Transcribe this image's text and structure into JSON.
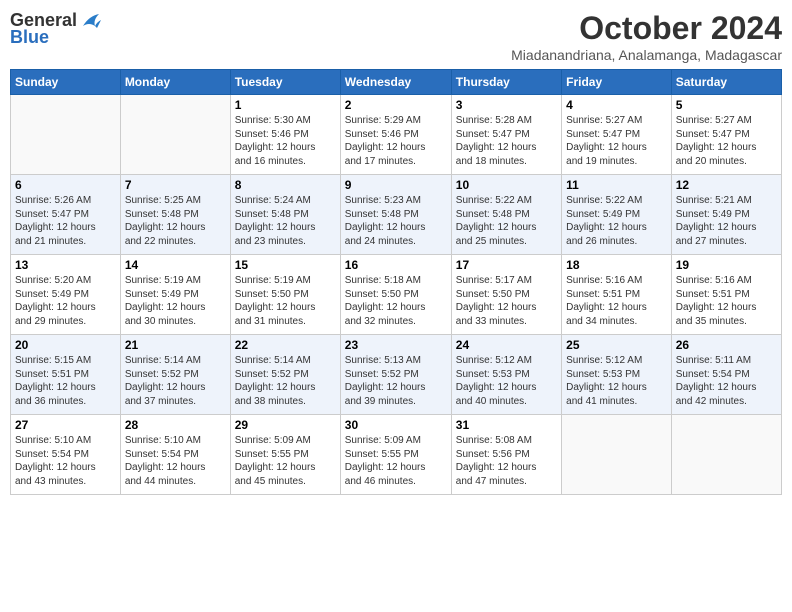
{
  "header": {
    "logo_line1": "General",
    "logo_line2": "Blue",
    "title": "October 2024",
    "location": "Miadanandriana, Analamanga, Madagascar"
  },
  "days_of_week": [
    "Sunday",
    "Monday",
    "Tuesday",
    "Wednesday",
    "Thursday",
    "Friday",
    "Saturday"
  ],
  "weeks": [
    [
      {
        "day": "",
        "info": ""
      },
      {
        "day": "",
        "info": ""
      },
      {
        "day": "1",
        "info": "Sunrise: 5:30 AM\nSunset: 5:46 PM\nDaylight: 12 hours\nand 16 minutes."
      },
      {
        "day": "2",
        "info": "Sunrise: 5:29 AM\nSunset: 5:46 PM\nDaylight: 12 hours\nand 17 minutes."
      },
      {
        "day": "3",
        "info": "Sunrise: 5:28 AM\nSunset: 5:47 PM\nDaylight: 12 hours\nand 18 minutes."
      },
      {
        "day": "4",
        "info": "Sunrise: 5:27 AM\nSunset: 5:47 PM\nDaylight: 12 hours\nand 19 minutes."
      },
      {
        "day": "5",
        "info": "Sunrise: 5:27 AM\nSunset: 5:47 PM\nDaylight: 12 hours\nand 20 minutes."
      }
    ],
    [
      {
        "day": "6",
        "info": "Sunrise: 5:26 AM\nSunset: 5:47 PM\nDaylight: 12 hours\nand 21 minutes."
      },
      {
        "day": "7",
        "info": "Sunrise: 5:25 AM\nSunset: 5:48 PM\nDaylight: 12 hours\nand 22 minutes."
      },
      {
        "day": "8",
        "info": "Sunrise: 5:24 AM\nSunset: 5:48 PM\nDaylight: 12 hours\nand 23 minutes."
      },
      {
        "day": "9",
        "info": "Sunrise: 5:23 AM\nSunset: 5:48 PM\nDaylight: 12 hours\nand 24 minutes."
      },
      {
        "day": "10",
        "info": "Sunrise: 5:22 AM\nSunset: 5:48 PM\nDaylight: 12 hours\nand 25 minutes."
      },
      {
        "day": "11",
        "info": "Sunrise: 5:22 AM\nSunset: 5:49 PM\nDaylight: 12 hours\nand 26 minutes."
      },
      {
        "day": "12",
        "info": "Sunrise: 5:21 AM\nSunset: 5:49 PM\nDaylight: 12 hours\nand 27 minutes."
      }
    ],
    [
      {
        "day": "13",
        "info": "Sunrise: 5:20 AM\nSunset: 5:49 PM\nDaylight: 12 hours\nand 29 minutes."
      },
      {
        "day": "14",
        "info": "Sunrise: 5:19 AM\nSunset: 5:49 PM\nDaylight: 12 hours\nand 30 minutes."
      },
      {
        "day": "15",
        "info": "Sunrise: 5:19 AM\nSunset: 5:50 PM\nDaylight: 12 hours\nand 31 minutes."
      },
      {
        "day": "16",
        "info": "Sunrise: 5:18 AM\nSunset: 5:50 PM\nDaylight: 12 hours\nand 32 minutes."
      },
      {
        "day": "17",
        "info": "Sunrise: 5:17 AM\nSunset: 5:50 PM\nDaylight: 12 hours\nand 33 minutes."
      },
      {
        "day": "18",
        "info": "Sunrise: 5:16 AM\nSunset: 5:51 PM\nDaylight: 12 hours\nand 34 minutes."
      },
      {
        "day": "19",
        "info": "Sunrise: 5:16 AM\nSunset: 5:51 PM\nDaylight: 12 hours\nand 35 minutes."
      }
    ],
    [
      {
        "day": "20",
        "info": "Sunrise: 5:15 AM\nSunset: 5:51 PM\nDaylight: 12 hours\nand 36 minutes."
      },
      {
        "day": "21",
        "info": "Sunrise: 5:14 AM\nSunset: 5:52 PM\nDaylight: 12 hours\nand 37 minutes."
      },
      {
        "day": "22",
        "info": "Sunrise: 5:14 AM\nSunset: 5:52 PM\nDaylight: 12 hours\nand 38 minutes."
      },
      {
        "day": "23",
        "info": "Sunrise: 5:13 AM\nSunset: 5:52 PM\nDaylight: 12 hours\nand 39 minutes."
      },
      {
        "day": "24",
        "info": "Sunrise: 5:12 AM\nSunset: 5:53 PM\nDaylight: 12 hours\nand 40 minutes."
      },
      {
        "day": "25",
        "info": "Sunrise: 5:12 AM\nSunset: 5:53 PM\nDaylight: 12 hours\nand 41 minutes."
      },
      {
        "day": "26",
        "info": "Sunrise: 5:11 AM\nSunset: 5:54 PM\nDaylight: 12 hours\nand 42 minutes."
      }
    ],
    [
      {
        "day": "27",
        "info": "Sunrise: 5:10 AM\nSunset: 5:54 PM\nDaylight: 12 hours\nand 43 minutes."
      },
      {
        "day": "28",
        "info": "Sunrise: 5:10 AM\nSunset: 5:54 PM\nDaylight: 12 hours\nand 44 minutes."
      },
      {
        "day": "29",
        "info": "Sunrise: 5:09 AM\nSunset: 5:55 PM\nDaylight: 12 hours\nand 45 minutes."
      },
      {
        "day": "30",
        "info": "Sunrise: 5:09 AM\nSunset: 5:55 PM\nDaylight: 12 hours\nand 46 minutes."
      },
      {
        "day": "31",
        "info": "Sunrise: 5:08 AM\nSunset: 5:56 PM\nDaylight: 12 hours\nand 47 minutes."
      },
      {
        "day": "",
        "info": ""
      },
      {
        "day": "",
        "info": ""
      }
    ]
  ]
}
